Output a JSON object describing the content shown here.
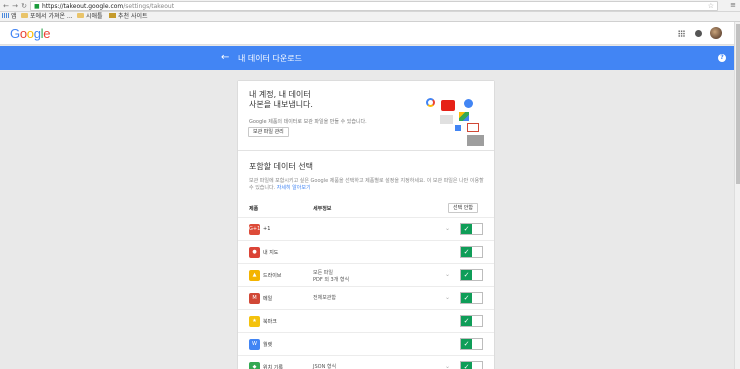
{
  "browser": {
    "url_host": "https://takeout.google.com",
    "url_path": "/settings/takeout",
    "bookmarks": [
      {
        "label": "앱",
        "icon": "apps-icon"
      },
      {
        "label": "포에서 가져온 ...",
        "icon": "folder-icon"
      },
      {
        "label": "시애틀",
        "icon": "folder-icon"
      },
      {
        "label": "추천 사이트",
        "icon": "bookmark-icon"
      }
    ]
  },
  "header": {
    "logo_letters": [
      "G",
      "o",
      "o",
      "g",
      "l",
      "e"
    ],
    "logo_colors": [
      "#4285f4",
      "#ea4335",
      "#fbbc05",
      "#4285f4",
      "#34a853",
      "#ea4335"
    ]
  },
  "bar": {
    "back": "←",
    "title": "내 데이터 다운로드",
    "help": "?",
    "color": "#4285f4"
  },
  "intro": {
    "title": "내 계정, 내 데이터\n사본을 내보냅니다.",
    "desc": "Google 제품의 데이터로 보관 파일을 만들 수 있습니다.",
    "manage_button": "보관 파일 관리"
  },
  "select": {
    "title": "포함할 데이터 선택",
    "desc": "보관 파일에 포함시키고 싶은 Google 제품을 선택하고 제품별로 설정을 지정하세요. 이 보관 파일은 나만 이용할 수 있습니다.",
    "link": "자세히 알아보기",
    "col_product": "제품",
    "col_details": "세부정보",
    "select_none": "선택 안함"
  },
  "products": [
    {
      "name": "+1",
      "icon_text": "G+1",
      "icon_color": "#dd4b39",
      "details": "",
      "has_chevron": true,
      "checked": true
    },
    {
      "name": "내 지도",
      "icon_text": "●",
      "icon_color": "#db4437",
      "details": "",
      "has_chevron": false,
      "checked": true
    },
    {
      "name": "드라이브",
      "icon_text": "▲",
      "icon_color": "#f4b400",
      "details": "모든 파일\nPDF 외 3개 형식",
      "has_chevron": true,
      "checked": true
    },
    {
      "name": "메일",
      "icon_text": "M",
      "icon_color": "#d14836",
      "details": "전체보관함",
      "has_chevron": true,
      "checked": true
    },
    {
      "name": "북마크",
      "icon_text": "★",
      "icon_color": "#f4c20d",
      "details": "",
      "has_chevron": false,
      "checked": true
    },
    {
      "name": "월렛",
      "icon_text": "W",
      "icon_color": "#4285f4",
      "details": "",
      "has_chevron": false,
      "checked": true
    },
    {
      "name": "위치 기록",
      "icon_text": "◆",
      "icon_color": "#34a853",
      "details": "JSON 형식",
      "has_chevron": true,
      "checked": true
    }
  ],
  "chevron": "⌄",
  "check": "✓"
}
